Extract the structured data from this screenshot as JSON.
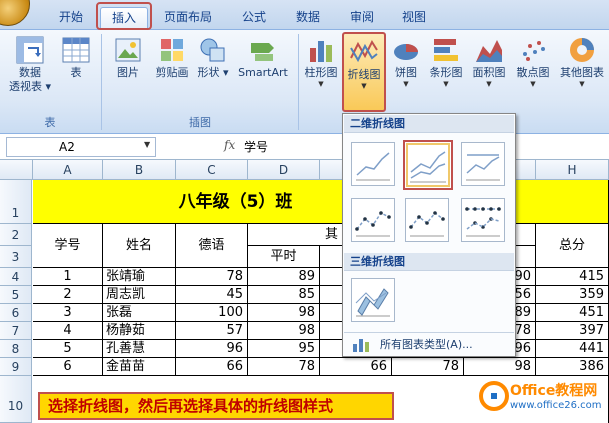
{
  "ribbon_tabs": [
    "开始",
    "插入",
    "页面布局",
    "公式",
    "数据",
    "审阅",
    "视图"
  ],
  "groups": {
    "tables": {
      "label": "表",
      "buttons": [
        "数据\n透视表",
        "表"
      ]
    },
    "illustrations": {
      "label": "插图",
      "buttons": [
        "图片",
        "剪贴画",
        "形状",
        "SmartArt"
      ]
    },
    "charts": {
      "buttons": [
        "柱形图",
        "折线图",
        "饼图",
        "条形图",
        "面积图",
        "散点图",
        "其他图表"
      ]
    }
  },
  "pivot_label_1": "数据",
  "pivot_label_2": "透视表",
  "formula_bar": {
    "name_box": "A2",
    "fx": "fx",
    "value": "学号"
  },
  "columns": [
    "A",
    "B",
    "C",
    "D",
    "",
    "",
    "",
    "H"
  ],
  "rows": [
    "1",
    "2",
    "3",
    "4",
    "5",
    "6",
    "7",
    "8",
    "9",
    "10"
  ],
  "sheet": {
    "title": "八年级（5）班",
    "headers": {
      "id": "学号",
      "name": "姓名",
      "moral": "德语",
      "regular": "平时",
      "mid": "其",
      "total": "总分"
    },
    "data": [
      {
        "id": "1",
        "name": "张靖瑜",
        "moral": "78",
        "regular": "89",
        "g": "90",
        "total": "415"
      },
      {
        "id": "2",
        "name": "周志凯",
        "moral": "45",
        "regular": "85",
        "g": "56",
        "total": "359"
      },
      {
        "id": "3",
        "name": "张磊",
        "moral": "100",
        "regular": "98",
        "g": "89",
        "total": "451"
      },
      {
        "id": "4",
        "name": "杨静茹",
        "moral": "57",
        "regular": "98",
        "g": "78",
        "total": "397"
      },
      {
        "id": "5",
        "name": "孔善慧",
        "moral": "96",
        "regular": "95",
        "g": "96",
        "total": "441"
      },
      {
        "id": "6",
        "name": "金苗苗",
        "moral": "66",
        "regular": "78",
        "g": "98",
        "extra": "66",
        "extra2": "78",
        "total": "386"
      }
    ]
  },
  "line_menu": {
    "section_2d": "二维折线图",
    "section_3d": "三维折线图",
    "all_types": "所有图表类型(A)..."
  },
  "caption": "选择折线图，然后再选择具体的折线图样式",
  "watermark": {
    "brand": "Office教程网",
    "url": "www.office26.com"
  },
  "colors": {
    "title_fill": "#ffff00",
    "highlight": "#c0504d",
    "caption_fill": "#ffd600",
    "caption_text": "#c00000"
  }
}
